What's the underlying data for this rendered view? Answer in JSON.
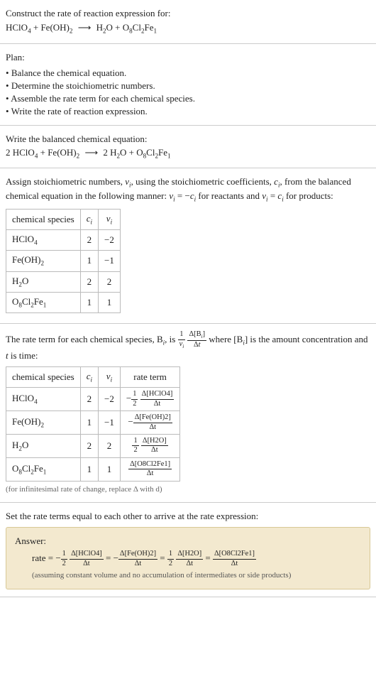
{
  "header": {
    "prompt": "Construct the rate of reaction expression for:",
    "eq_lhs1": "HClO",
    "eq_lhs1_sub": "4",
    "plus": " + ",
    "eq_lhs2": "Fe(OH)",
    "eq_lhs2_sub": "2",
    "arrow": "⟶",
    "eq_rhs1": "H",
    "eq_rhs1_sub": "2",
    "eq_rhs1b": "O + O",
    "eq_rhs1c_sub": "8",
    "eq_rhs1d": "Cl",
    "eq_rhs1e_sub": "2",
    "eq_rhs1f": "Fe",
    "eq_rhs1g_sub": "1"
  },
  "plan": {
    "title": "Plan:",
    "items": [
      "Balance the chemical equation.",
      "Determine the stoichiometric numbers.",
      "Assemble the rate term for each chemical species.",
      "Write the rate of reaction expression."
    ]
  },
  "balanced": {
    "title": "Write the balanced chemical equation:",
    "c1": "2 HClO",
    "s1": "4",
    "plus": " + Fe(OH)",
    "s2": "2",
    "arrow": "⟶",
    "c3": " 2 H",
    "s3": "2",
    "c4": "O + O",
    "s4": "8",
    "c5": "Cl",
    "s5": "2",
    "c6": "Fe",
    "s6": "1"
  },
  "stoich": {
    "intro1": "Assign stoichiometric numbers, ",
    "nu": "ν",
    "sub_i": "i",
    "intro2": ", using the stoichiometric coefficients, ",
    "c": "c",
    "intro3": ", from the balanced chemical equation in the following manner: ",
    "rel1a": "ν",
    "rel1b": " = −",
    "rel1c": "c",
    "rel1d": " for reactants and ",
    "rel2a": "ν",
    "rel2b": " = ",
    "rel2c": "c",
    "rel2d": " for products:",
    "headers": {
      "species": "chemical species",
      "ci": "c",
      "nui": "ν"
    },
    "rows": [
      {
        "sp_a": "HClO",
        "sp_sub": "4",
        "ci": "2",
        "nui": "−2"
      },
      {
        "sp_a": "Fe(OH)",
        "sp_sub": "2",
        "ci": "1",
        "nui": "−1"
      },
      {
        "sp_a": "H",
        "sp_sub": "2",
        "sp_b": "O",
        "ci": "2",
        "nui": "2"
      },
      {
        "sp_a": "O",
        "sp_sub": "8",
        "sp_b": "Cl",
        "sp_sub2": "2",
        "sp_c": "Fe",
        "sp_sub3": "1",
        "ci": "1",
        "nui": "1"
      }
    ]
  },
  "rateterm": {
    "intro1": "The rate term for each chemical species, B",
    "intro2": ", is ",
    "frac1_num": "1",
    "frac1_den_a": "ν",
    "frac2_num_a": "Δ[B",
    "frac2_num_b": "]",
    "frac2_den_a": "Δ",
    "frac2_den_b": "t",
    "intro3": " where [B",
    "intro4": "] is the amount concentration and ",
    "t": "t",
    "intro5": " is time:",
    "headers": {
      "species": "chemical species",
      "ci": "c",
      "nui": "ν",
      "rt": "rate term"
    },
    "rows": [
      {
        "sp_a": "HClO",
        "sp_sub": "4",
        "ci": "2",
        "nui": "−2",
        "sign": "−",
        "fnum": "1",
        "fden": "2",
        "conc": "Δ[HClO4]",
        "dt": "Δt"
      },
      {
        "sp_a": "Fe(OH)",
        "sp_sub": "2",
        "ci": "1",
        "nui": "−1",
        "sign": "−",
        "fnum": "",
        "fden": "",
        "conc": "Δ[Fe(OH)2]",
        "dt": "Δt"
      },
      {
        "sp_a": "H",
        "sp_sub": "2",
        "sp_b": "O",
        "ci": "2",
        "nui": "2",
        "sign": "",
        "fnum": "1",
        "fden": "2",
        "conc": "Δ[H2O]",
        "dt": "Δt"
      },
      {
        "sp_a": "O",
        "sp_sub": "8",
        "sp_b": "Cl",
        "sp_sub2": "2",
        "sp_c": "Fe",
        "sp_sub3": "1",
        "ci": "1",
        "nui": "1",
        "sign": "",
        "fnum": "",
        "fden": "",
        "conc": "Δ[O8Cl2Fe1]",
        "dt": "Δt"
      }
    ],
    "note": "(for infinitesimal rate of change, replace Δ with d)"
  },
  "final": {
    "title": "Set the rate terms equal to each other to arrive at the rate expression:",
    "answer_label": "Answer:",
    "rate": "rate = ",
    "eq": "=",
    "minus": "−",
    "half_num": "1",
    "half_den": "2",
    "t1": "Δ[HClO4]",
    "t2": "Δ[Fe(OH)2]",
    "t3": "Δ[H2O]",
    "t4": "Δ[O8Cl2Fe1]",
    "dt": "Δt",
    "note": "(assuming constant volume and no accumulation of intermediates or side products)"
  }
}
